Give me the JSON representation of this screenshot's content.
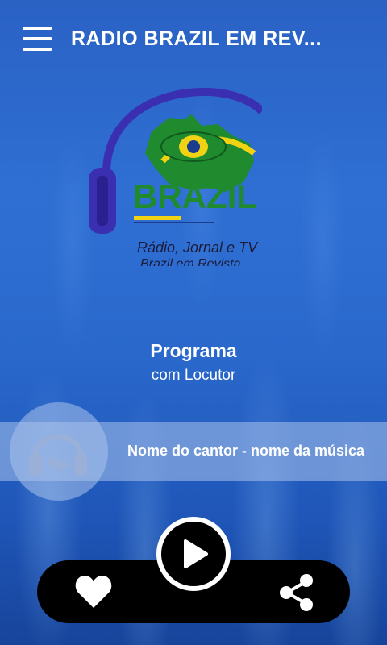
{
  "app_bar": {
    "title": "RADIO BRAZIL EM REV...",
    "menu_icon": "hamburger-menu-icon"
  },
  "logo": {
    "brand": "BRAZIL",
    "tagline": "Rádio, Jornal e TV",
    "subline": "Brazil em Revista",
    "colors": {
      "green": "#1f8a2e",
      "yellow": "#f2d314",
      "blue": "#1b3c8f",
      "headset": "#3a2fb0"
    }
  },
  "program": {
    "name": "Programa",
    "host": "com Locutor"
  },
  "now_playing": {
    "track": "Nome do cantor - nome da música",
    "icon": "headphones-icon"
  },
  "controls": {
    "favorite_icon": "heart-icon",
    "play_icon": "play-icon",
    "share_icon": "share-icon"
  }
}
